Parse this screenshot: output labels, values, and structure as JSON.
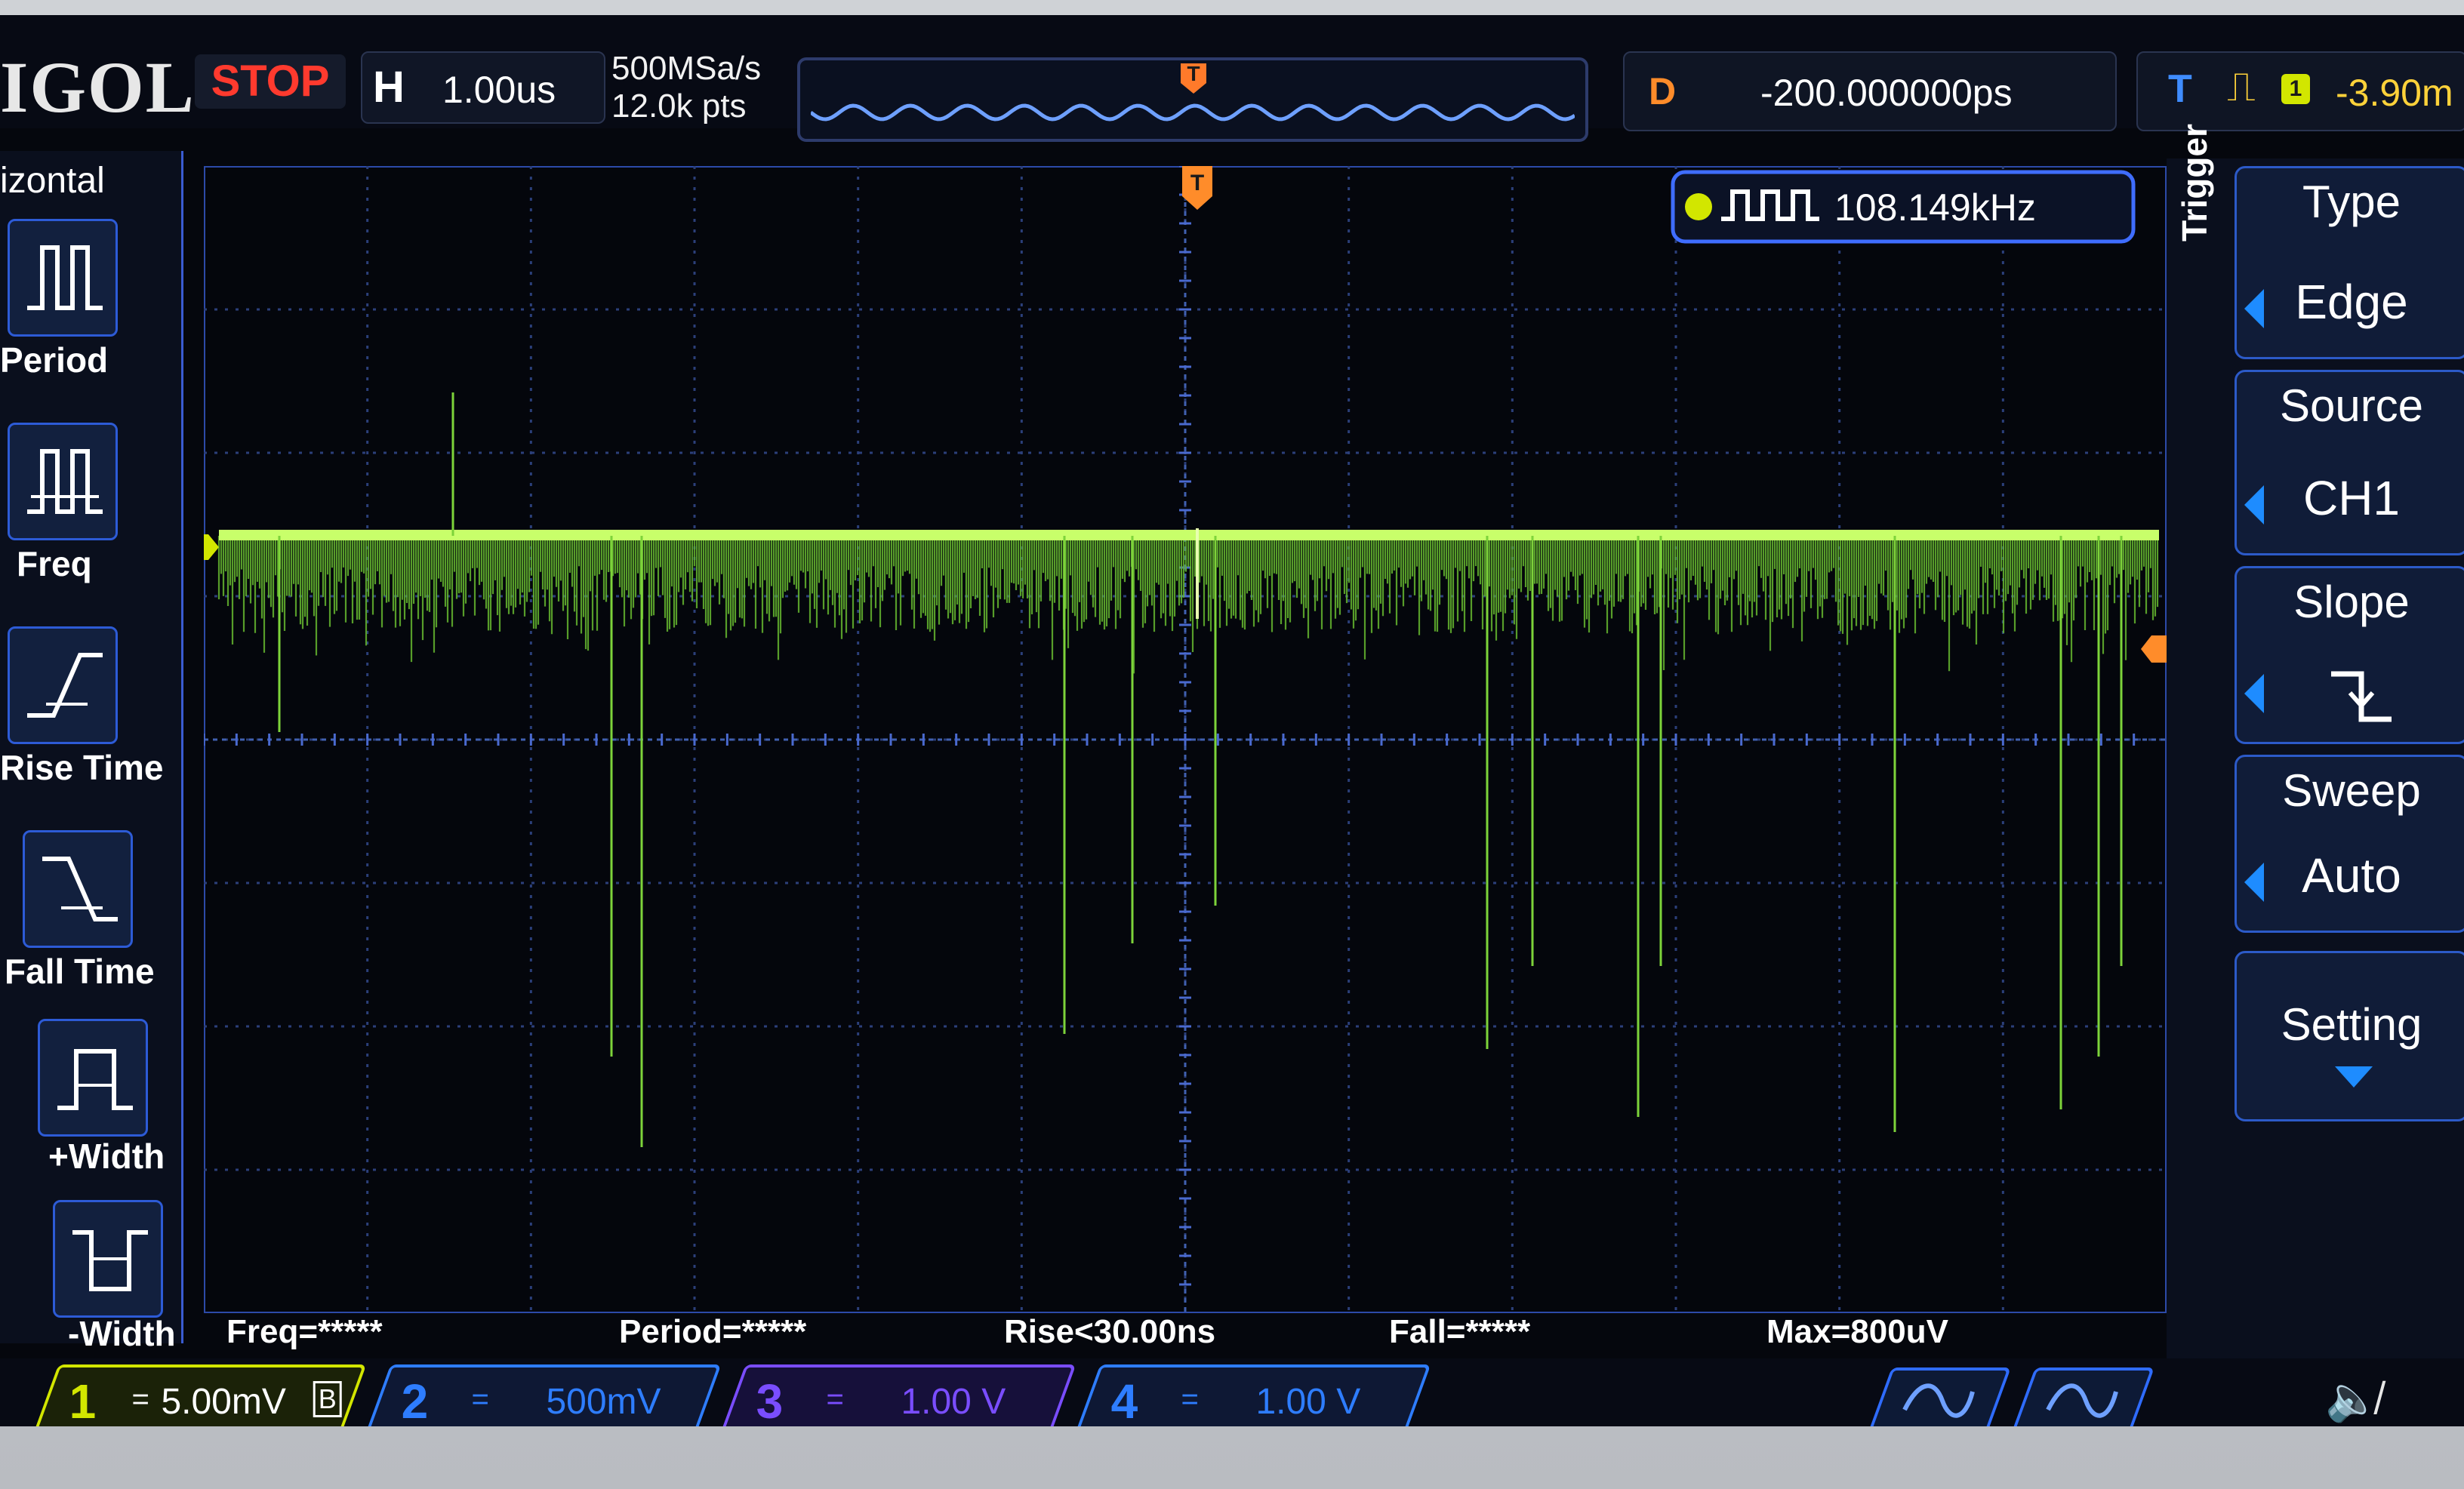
{
  "top": {
    "brand": "IGOL",
    "run_state": "STOP",
    "horizontal": {
      "label": "H",
      "timebase": "1.00us"
    },
    "sample_rate": "500MSa/s",
    "memory_depth": "12.0k pts",
    "delay": {
      "label": "D",
      "value": "-200.000000ps"
    },
    "trigger": {
      "label": "T",
      "slope_icon": "falling-edge-icon",
      "channel": "1",
      "level": "-3.90m"
    }
  },
  "left_panel": {
    "title": "izontal",
    "items": [
      {
        "label": "Period",
        "icon": "period-icon"
      },
      {
        "label": "Freq",
        "icon": "frequency-icon"
      },
      {
        "label": "Rise Time",
        "icon": "rise-time-icon"
      },
      {
        "label": "Fall Time",
        "icon": "fall-time-icon"
      },
      {
        "label": "+Width",
        "icon": "positive-width-icon"
      },
      {
        "label": "-Width",
        "icon": "negative-width-icon"
      }
    ]
  },
  "plot": {
    "freq_counter": {
      "channel": "1",
      "value": "108.149kHz"
    },
    "channel_marker": "1",
    "trigger_marker": "T",
    "trace_color": "#7dd33a"
  },
  "right_panel": {
    "menu_title": "Trigger",
    "type": {
      "label": "Type",
      "value": "Edge"
    },
    "source": {
      "label": "Source",
      "value": "CH1"
    },
    "slope": {
      "label": "Slope",
      "value_icon": "falling-slope-icon"
    },
    "sweep": {
      "label": "Sweep",
      "value": "Auto"
    },
    "setting": {
      "label": "Setting"
    }
  },
  "measurements": {
    "freq": "Freq=*****",
    "period": "Period=*****",
    "rise": "Rise<30.00ns",
    "fall": "Fall=*****",
    "max": "Max=800uV"
  },
  "channels": [
    {
      "num": "1",
      "coupling": "=",
      "scale": "5.00mV",
      "bw": "B",
      "color": "#d2e600"
    },
    {
      "num": "2",
      "coupling": "=",
      "scale": "500mV",
      "color": "#2e7dff"
    },
    {
      "num": "3",
      "coupling": "=",
      "scale": "1.00 V",
      "color": "#7a4dff"
    },
    {
      "num": "4",
      "coupling": "=",
      "scale": "1.00 V",
      "color": "#2e7dff"
    }
  ],
  "colors": {
    "accent": "#2c5ac8",
    "stop": "#ff3a2e",
    "delay": "#ff8c2a",
    "trigger": "#3f8cff",
    "ch1": "#d2e600"
  }
}
